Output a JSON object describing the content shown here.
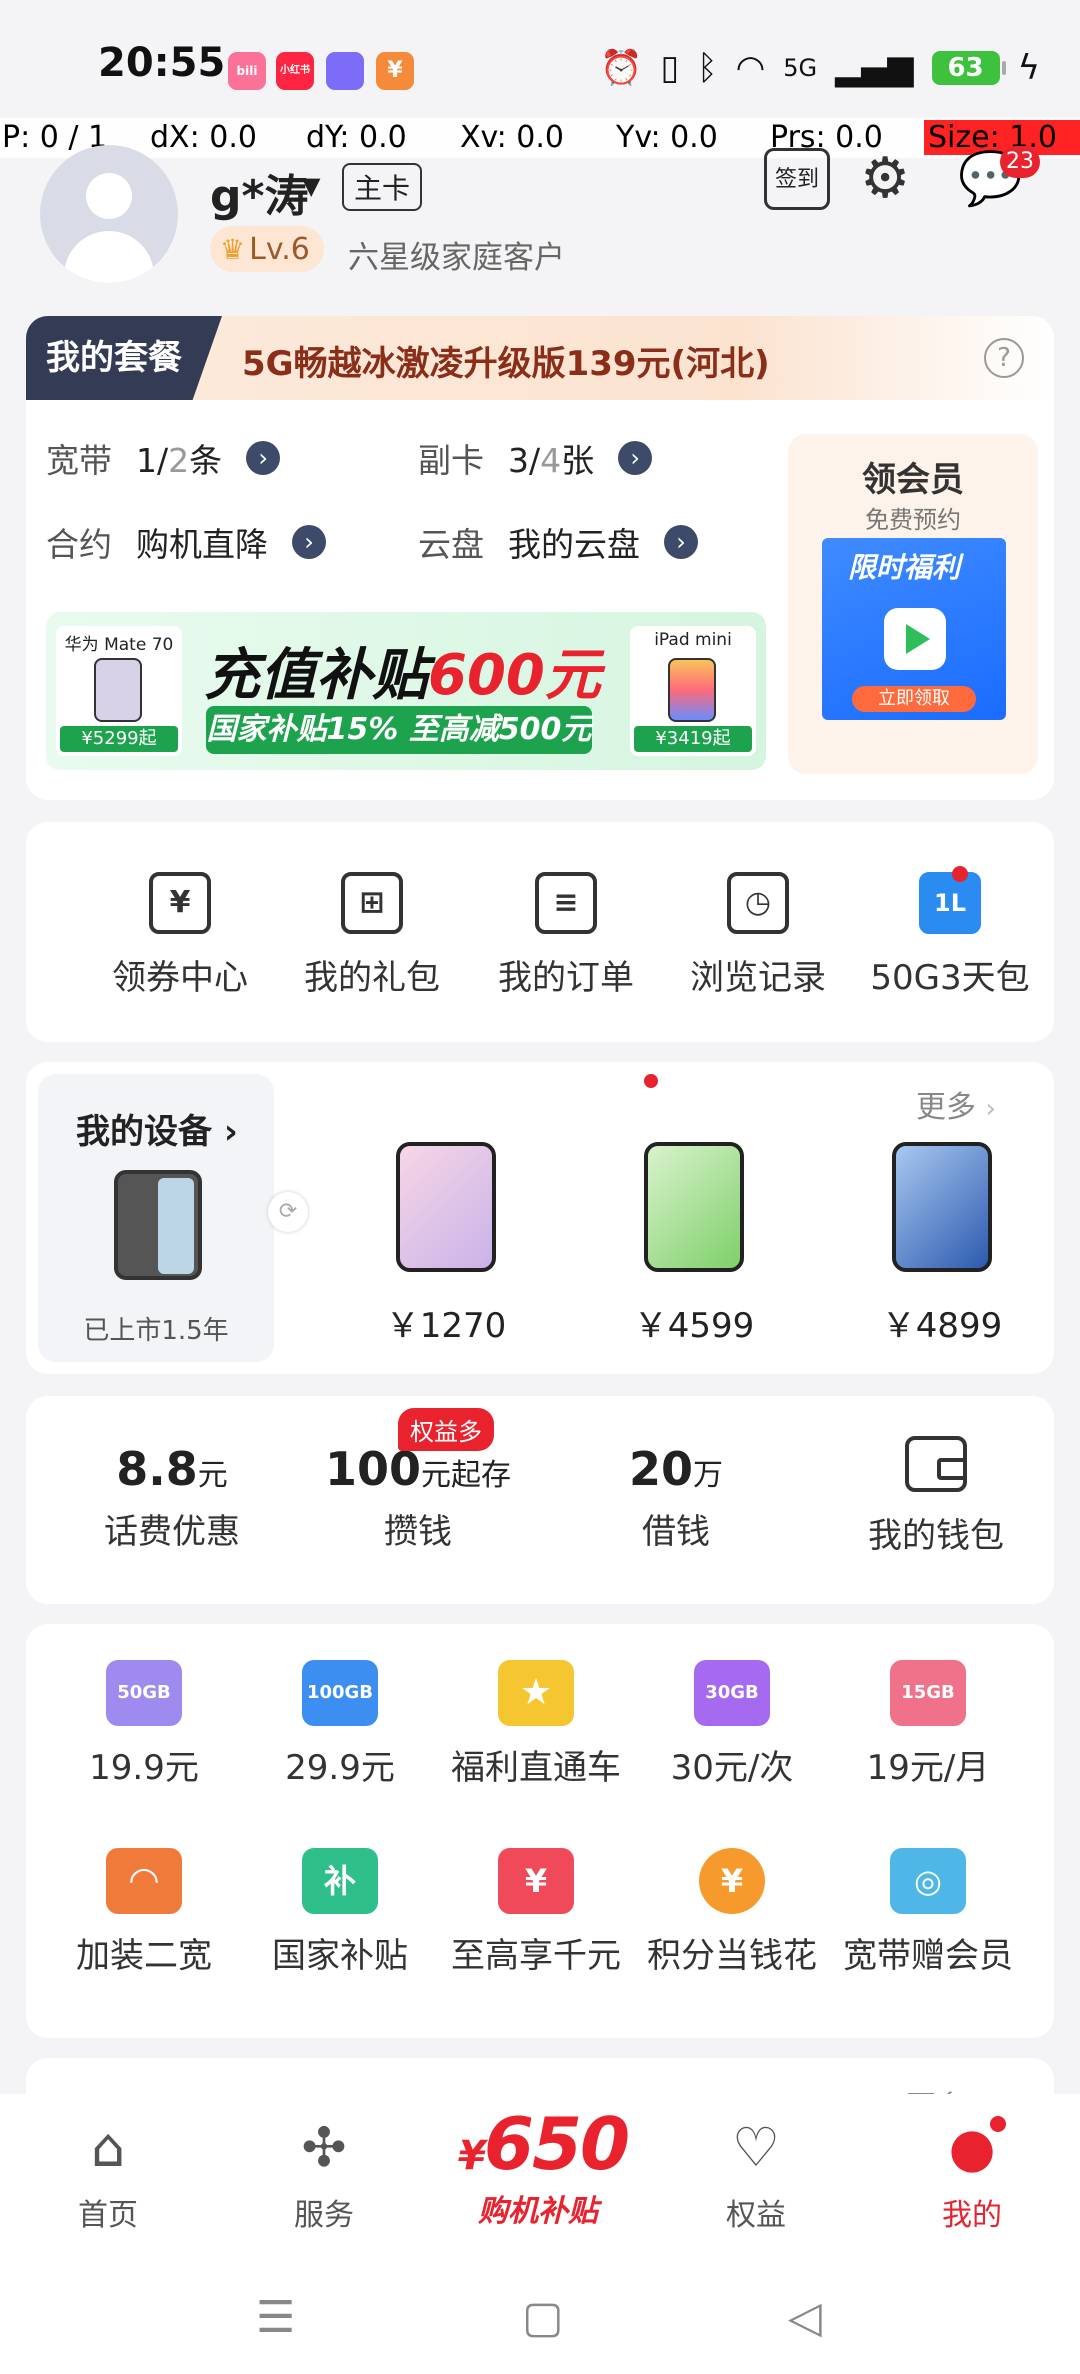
{
  "status_bar": {
    "time": "20:55",
    "app_badges": [
      {
        "name": "bilibili",
        "label": "bili",
        "color": "#fb7299"
      },
      {
        "name": "xiaohongshu",
        "label": "小红书",
        "color": "#ff2442"
      },
      {
        "name": "app-color",
        "label": "",
        "color": "#7d6cf7"
      },
      {
        "name": "app-yen",
        "label": "¥",
        "color": "#f58a3a"
      }
    ],
    "network": "5G",
    "battery": "63"
  },
  "debug": {
    "p": "P: 0 / 1",
    "dx": "dX: 0.0",
    "dy": "dY: 0.0",
    "xv": "Xv: 0.0",
    "yv": "Yv: 0.0",
    "prs": "Prs: 0.0",
    "size": "Size: 1.0"
  },
  "profile": {
    "username": "g*涛",
    "card_tag": "主卡",
    "level": "Lv.6",
    "level_desc": "六星级家庭客户",
    "signin_label": "签到",
    "message_count": "23"
  },
  "package": {
    "title": "我的套餐",
    "name": "5G畅越冰激凌升级版139元(河北)",
    "help": "?",
    "rows": [
      {
        "label": "宽带",
        "value": "1/",
        "value_muted": "2",
        "unit": "条"
      },
      {
        "label": "副卡",
        "value": "3/",
        "value_muted": "4",
        "unit": "张"
      },
      {
        "label": "合约",
        "value": "购机直降",
        "value_muted": "",
        "unit": ""
      },
      {
        "label": "云盘",
        "value": "我的云盘",
        "value_muted": "",
        "unit": ""
      }
    ],
    "member": {
      "title": "领会员",
      "subtitle": "免费预约",
      "img_tag": "限时福利",
      "img_btn": "立即领取"
    },
    "banner": {
      "left_phone": "华为 Mate 70",
      "left_price": "¥5299起",
      "main_black": "充值补贴",
      "main_red": "600元",
      "sub": "国家补贴15%  至高减500元",
      "right_phone": "iPad mini",
      "right_price": "¥3419起"
    }
  },
  "quick_actions": [
    {
      "label": "领券中心",
      "icon": "coupon-icon",
      "glyph": "¥"
    },
    {
      "label": "我的礼包",
      "icon": "gift-icon",
      "glyph": "⊞"
    },
    {
      "label": "我的订单",
      "icon": "order-icon",
      "glyph": "≡"
    },
    {
      "label": "浏览记录",
      "icon": "history-icon",
      "glyph": "◷"
    },
    {
      "label": "50G3天包",
      "icon": "data-pack-icon",
      "glyph": "1L"
    }
  ],
  "devices": {
    "title": "我的设备",
    "chevron": "›",
    "mine_sub": "已上市1.5年",
    "more": "更多",
    "items": [
      {
        "price": "￥1270",
        "color": "#f2c6d8"
      },
      {
        "price": "￥4599",
        "color": "#b6e2a8"
      },
      {
        "price": "￥4899",
        "color": "#5d8ed8"
      }
    ]
  },
  "finance": {
    "badge": "权益多",
    "items": [
      {
        "num": "8.8",
        "unit": "元",
        "label": "话费优惠"
      },
      {
        "num": "100",
        "unit": "元起存",
        "label": "攒钱"
      },
      {
        "num": "20",
        "unit": "万",
        "label": "借钱"
      },
      {
        "num": "",
        "unit": "",
        "label": "我的钱包"
      }
    ]
  },
  "grid": [
    {
      "label": "19.9元",
      "icon": "data-50gb-icon",
      "text": "50GB",
      "color": "#9f8bf0"
    },
    {
      "label": "29.9元",
      "icon": "data-100gb-icon",
      "text": "100GB",
      "color": "#3c8ff0"
    },
    {
      "label": "福利直通车",
      "icon": "welfare-icon",
      "text": "★",
      "color": "#f6c631"
    },
    {
      "label": "30元/次",
      "icon": "data-30gb-icon",
      "text": "30GB",
      "color": "#a56af0"
    },
    {
      "label": "19元/月",
      "icon": "data-15gb-icon",
      "text": "15GB",
      "color": "#f0718a"
    },
    {
      "label": "加装二宽",
      "icon": "router-icon",
      "text": "◠",
      "color": "#f07a3a"
    },
    {
      "label": "国家补贴",
      "icon": "subsidy-icon",
      "text": "补",
      "color": "#2fbf8a"
    },
    {
      "label": "至高享千元",
      "icon": "ticket-icon",
      "text": "¥",
      "color": "#f04a5a"
    },
    {
      "label": "积分当钱花",
      "icon": "points-icon",
      "text": "¥",
      "color": "#f79a2e"
    },
    {
      "label": "宽带赠会员",
      "icon": "broadband-vip-icon",
      "text": "◎",
      "color": "#4fb6e8"
    }
  ],
  "peek": {
    "more": "更多"
  },
  "bottom_nav": {
    "items": [
      {
        "label": "首页",
        "icon": "home-icon",
        "glyph": "⌂"
      },
      {
        "label": "服务",
        "icon": "service-icon",
        "glyph": "✣"
      },
      {
        "label": "权益",
        "icon": "benefits-icon",
        "glyph": "♡"
      },
      {
        "label": "我的",
        "icon": "profile-icon",
        "glyph": "●"
      }
    ],
    "promo_yen": "¥",
    "promo_num": "650",
    "promo_sub": "购机补贴"
  },
  "colors": {
    "accent": "#e8232e",
    "dark": "#343c55",
    "green": "#1da34d"
  }
}
